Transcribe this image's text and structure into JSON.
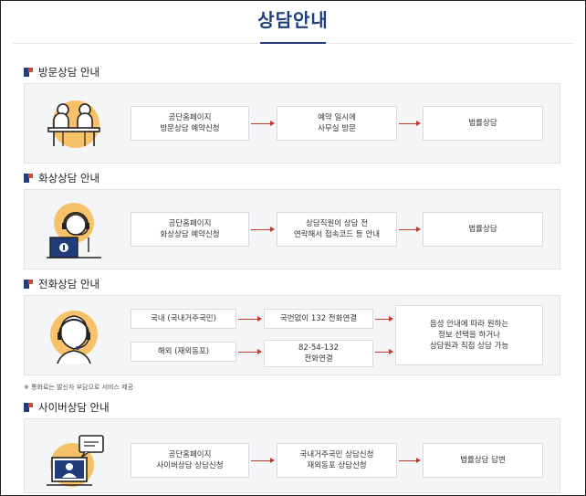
{
  "page": {
    "title": "상담안내"
  },
  "sections": [
    {
      "title": "방문상담 안내",
      "steps": [
        "공단홈페이지\n방문상담 예약신청",
        "예약 일시에\n사무실 방문",
        "법률상담"
      ]
    },
    {
      "title": "화상상담 안내",
      "steps": [
        "공단홈페이지\n화상상담 예약신청",
        "상담직원이 상담 전\n연락해서 접속코드 등 안내",
        "법률상담"
      ]
    },
    {
      "title": "전화상담 안내",
      "domestic": "국내 (국내거주국민)",
      "overseas": "해외 (재외동포)",
      "domestic_connect": "국번없이 132 전화연결",
      "overseas_connect": "82-54-132\n전화연결",
      "result": "음성 안내에 따라 원하는\n정보 선택을 하거나\n상담원과 직접 상담 가능",
      "note": "※ 통화료는 발신자 부담으로 서비스 제공"
    },
    {
      "title": "사이버상담 안내",
      "steps": [
        "공단홈페이지\n사이버상담 상담신청",
        "국내거주국민 상담신청\n재외동포 상담신청",
        "법률상담 답변"
      ]
    }
  ],
  "icons": [
    "visit-consultation-icon",
    "video-consultation-icon",
    "phone-consultation-icon",
    "cyber-consultation-icon"
  ],
  "colors": {
    "navy": "#1f3d7a",
    "accent_red": "#e2452f",
    "arrow": "#c0392b",
    "illustration_yellow": "#f7c16a"
  }
}
